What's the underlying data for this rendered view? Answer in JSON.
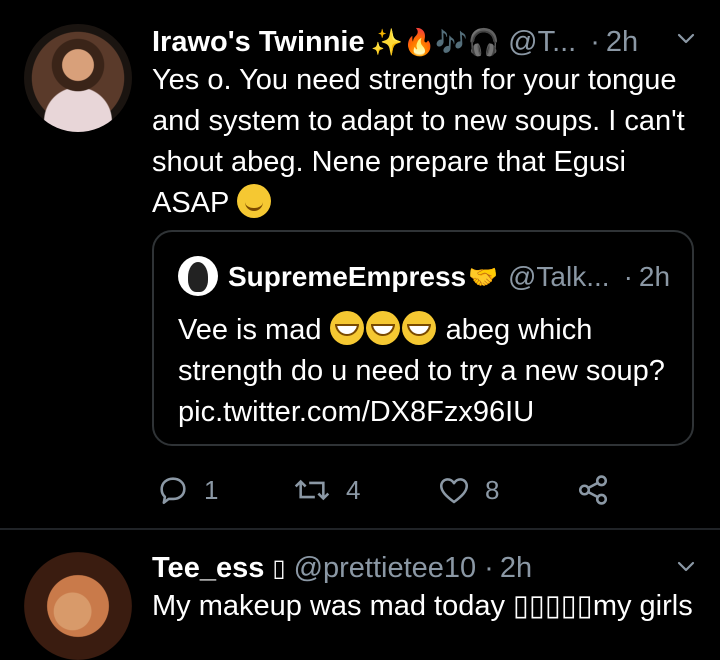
{
  "tweet1": {
    "author_name": "Irawo's Twinnie",
    "author_emojis": "✨🔥🎶🎧",
    "handle": "@T...",
    "dot": "·",
    "time": "2h",
    "text": "Yes o. You need strength for your tongue and system to adapt to new soups. I can't shout abeg. Nene prepare that Egusi ASAP",
    "quoted": {
      "author_name": "SupremeEmpress",
      "handle": "@Talk...",
      "dot": "·",
      "time": "2h",
      "text_before": "Vee is mad",
      "text_after": "abeg which strength do u need to try a new soup? pic.twitter.com/DX8Fzx96IU"
    },
    "actions": {
      "reply_count": "1",
      "retweet_count": "4",
      "like_count": "8"
    }
  },
  "tweet2": {
    "author_name": "Tee_ess",
    "name_glyph": "▯",
    "handle": "@prettietee10",
    "dot": "·",
    "time": "2h",
    "text": "My makeup was mad today ▯▯▯▯▯my girls"
  },
  "colors": {
    "background": "#000000",
    "text": "#ffffff",
    "secondary_text": "#8b98a5",
    "border": "#2f3336"
  },
  "icons": [
    "chevron-down-icon",
    "reply-icon",
    "retweet-icon",
    "like-icon",
    "share-icon"
  ]
}
